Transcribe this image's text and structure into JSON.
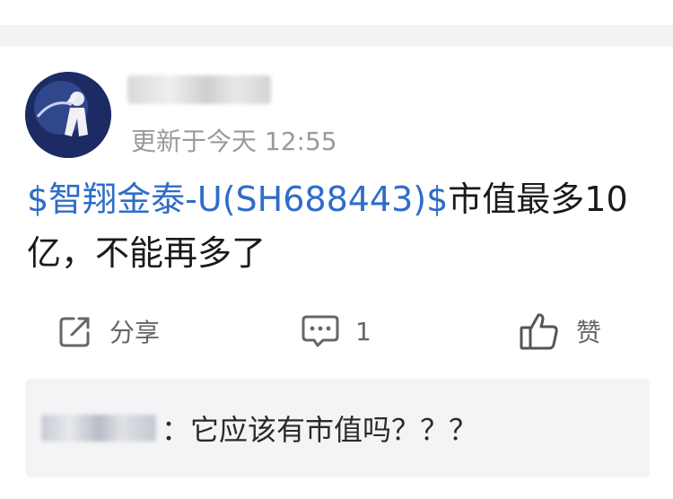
{
  "post": {
    "time": "更新于今天 12:55",
    "stock_link": "$智翔金泰-U(SH688443)$",
    "text": "市值最多10亿，不能再多了"
  },
  "actions": {
    "share_label": "分享",
    "comment_count": "1",
    "like_label": "赞"
  },
  "reply": {
    "text": "：它应该有市值吗？？？"
  },
  "icons": {
    "share": "share-icon",
    "comment": "comment-icon",
    "like": "thumbs-up-icon"
  },
  "colors": {
    "link": "#2f6dc7",
    "meta": "#9a9a9a",
    "reply_bg": "#f4f4f6"
  }
}
